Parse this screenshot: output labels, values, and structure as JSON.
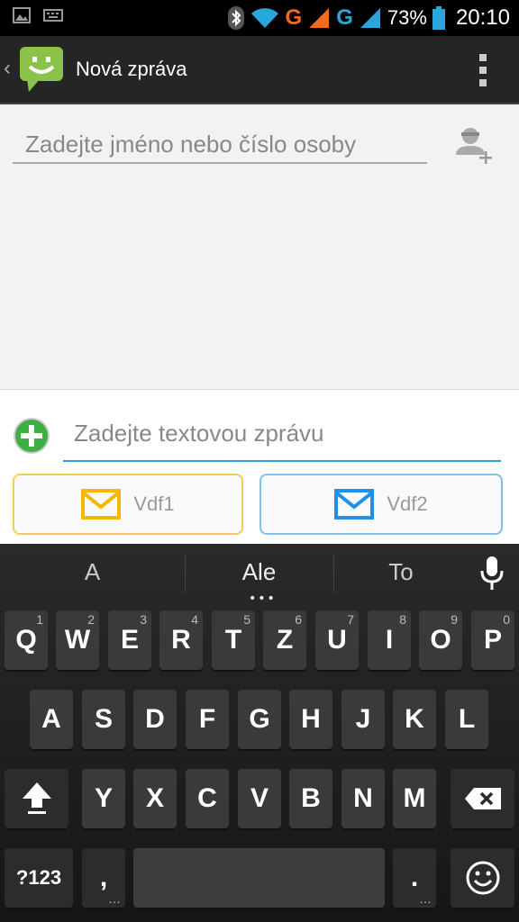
{
  "status_bar": {
    "battery": "73%",
    "time": "20:10",
    "network_1": "G",
    "network_2": "G",
    "colors": {
      "orange": "#f26a1b",
      "blue": "#2aa7d9"
    }
  },
  "action_bar": {
    "title": "Nová zpráva",
    "back_glyph": "‹",
    "icons": [
      "messaging-app-icon",
      "overflow-menu-icon"
    ]
  },
  "recipient": {
    "placeholder": "Zadejte jméno nebo číslo osoby",
    "value": ""
  },
  "compose": {
    "placeholder": "Zadejte textovou zprávu",
    "value": "",
    "sim1_label": "Vdf1",
    "sim2_label": "Vdf2",
    "colors": {
      "sim1": "#f5b800",
      "sim2": "#1e90e8",
      "attach": "#3cb043"
    }
  },
  "keyboard": {
    "suggestions": [
      "A",
      "Ale",
      "To"
    ],
    "row1": [
      {
        "label": "Q",
        "hint": "1"
      },
      {
        "label": "W",
        "hint": "2"
      },
      {
        "label": "E",
        "hint": "3"
      },
      {
        "label": "R",
        "hint": "4"
      },
      {
        "label": "T",
        "hint": "5"
      },
      {
        "label": "Z",
        "hint": "6"
      },
      {
        "label": "U",
        "hint": "7"
      },
      {
        "label": "I",
        "hint": "8"
      },
      {
        "label": "O",
        "hint": "9"
      },
      {
        "label": "P",
        "hint": "0"
      }
    ],
    "row2": [
      "A",
      "S",
      "D",
      "F",
      "G",
      "H",
      "J",
      "K",
      "L"
    ],
    "row3": [
      "Y",
      "X",
      "C",
      "V",
      "B",
      "N",
      "M"
    ],
    "symbols_label": "?123",
    "comma": ",",
    "period": "."
  }
}
